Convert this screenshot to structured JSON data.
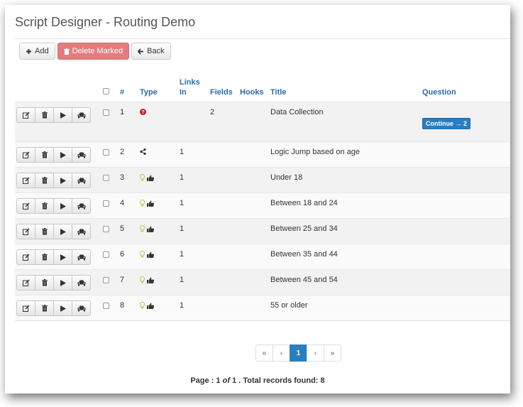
{
  "page_title": "Script Designer - Routing Demo",
  "toolbar": {
    "add_label": "Add",
    "delete_label": "Delete Marked",
    "back_label": "Back"
  },
  "columns": {
    "number": "#",
    "type": "Type",
    "links_in_1": "Links",
    "links_in_2": "In",
    "fields": "Fields",
    "hooks": "Hooks",
    "title": "Title",
    "question": "Question"
  },
  "rows": [
    {
      "num": "1",
      "type_icons": [
        "question-circle-icon"
      ],
      "links_in": "",
      "fields": "2",
      "hooks": "",
      "title": "Data Collection",
      "question_button": "Continue → 2"
    },
    {
      "num": "2",
      "type_icons": [
        "share-icon"
      ],
      "links_in": "1",
      "fields": "",
      "hooks": "",
      "title": "Logic Jump based on age"
    },
    {
      "num": "3",
      "type_icons": [
        "lightbulb-icon",
        "thumbs-up-icon"
      ],
      "links_in": "1",
      "fields": "",
      "hooks": "",
      "title": "Under 18"
    },
    {
      "num": "4",
      "type_icons": [
        "lightbulb-icon",
        "thumbs-up-icon"
      ],
      "links_in": "1",
      "fields": "",
      "hooks": "",
      "title": "Between 18 and 24"
    },
    {
      "num": "5",
      "type_icons": [
        "lightbulb-icon",
        "thumbs-up-icon"
      ],
      "links_in": "1",
      "fields": "",
      "hooks": "",
      "title": "Between 25 and 34"
    },
    {
      "num": "6",
      "type_icons": [
        "lightbulb-icon",
        "thumbs-up-icon"
      ],
      "links_in": "1",
      "fields": "",
      "hooks": "",
      "title": "Between 35 and 44"
    },
    {
      "num": "7",
      "type_icons": [
        "lightbulb-icon",
        "thumbs-up-icon"
      ],
      "links_in": "1",
      "fields": "",
      "hooks": "",
      "title": "Between 45 and 54"
    },
    {
      "num": "8",
      "type_icons": [
        "lightbulb-icon",
        "thumbs-up-icon"
      ],
      "links_in": "1",
      "fields": "",
      "hooks": "",
      "title": "55 or older"
    }
  ],
  "row_actions": [
    "edit-icon",
    "trash-icon",
    "play-icon",
    "car-icon"
  ],
  "pagination": {
    "first": "«",
    "prev": "‹",
    "current": "1",
    "next": "›",
    "last": "»"
  },
  "footer": {
    "page_label": "Page : 1",
    "of_label": "of",
    "total_label": "1 . Total records found: 8"
  },
  "colors": {
    "accent": "#2a7ec0",
    "link": "#2a6cb0",
    "danger": "#e17d7d",
    "error_icon": "#cc2222",
    "bulb_icon": "#b8c84a"
  }
}
